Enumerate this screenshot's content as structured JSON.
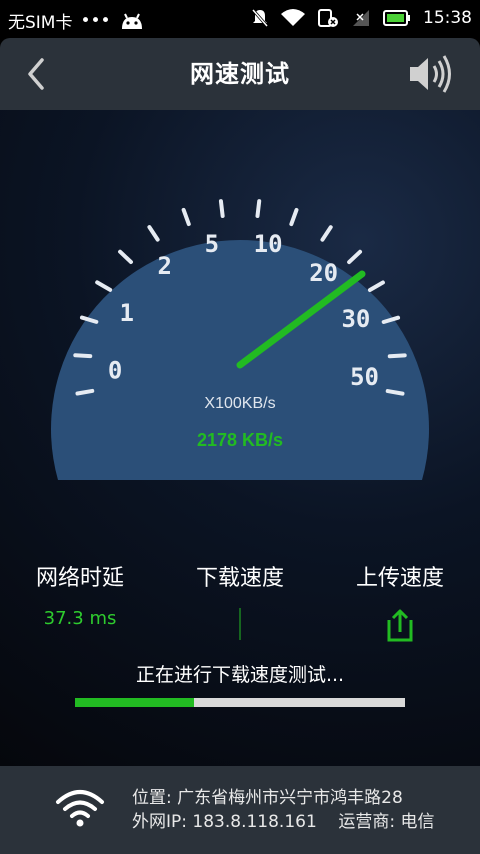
{
  "statusbar": {
    "carrier": "无SIM卡",
    "dots": "•••",
    "time": "15:38"
  },
  "header": {
    "title": "网速测试"
  },
  "gauge": {
    "ticks_labels": [
      "0",
      "1",
      "2",
      "5",
      "10",
      "20",
      "30",
      "50"
    ],
    "unit": "X100KB/s",
    "speed_text": "2178 KB/s",
    "needle_value": 21.78
  },
  "metrics": {
    "latency_label": "网络时延",
    "latency_value": "37.3 ms",
    "download_label": "下载速度",
    "upload_label": "上传速度"
  },
  "status": {
    "text": "正在进行下载速度测试...",
    "progress": 0.36
  },
  "footer": {
    "location": "位置: 广东省梅州市兴宁市鸿丰路28",
    "ip_line": "外网IP: 183.8.118.161    运营商: 电信"
  },
  "colors": {
    "accent": "#22bb22",
    "panel": "#2b323a"
  }
}
